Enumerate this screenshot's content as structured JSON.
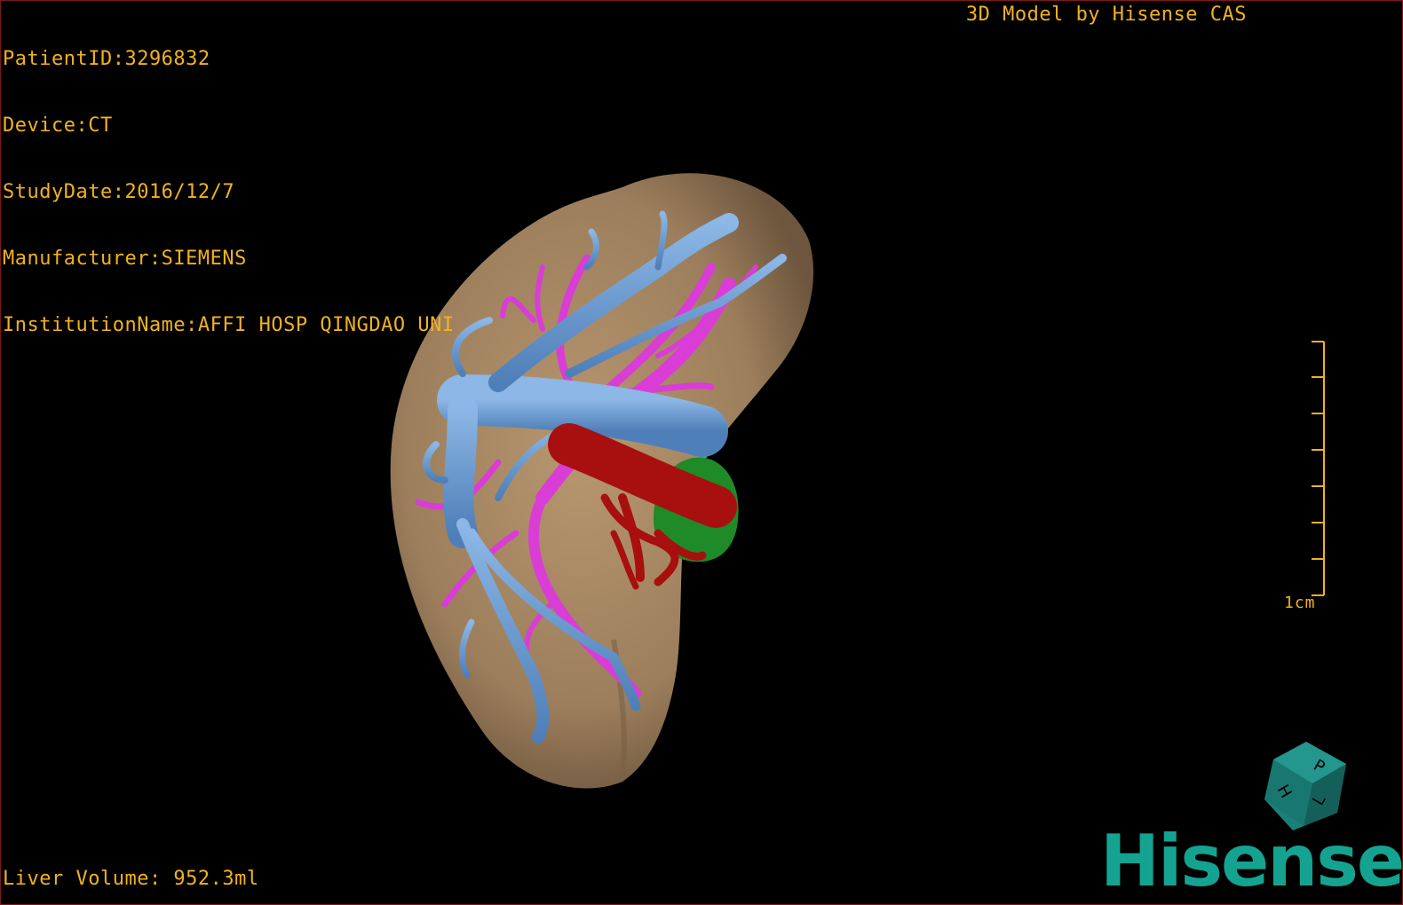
{
  "study_info": {
    "patient_id": "PatientID:3296832",
    "device": "Device:CT",
    "study_date": "StudyDate:2016/12/7",
    "manufacturer": "Manufacturer:SIEMENS",
    "institution": "InstitutionName:AFFI HOSP QINGDAO UNI"
  },
  "header": {
    "model_credit": "3D Model by Hisense CAS"
  },
  "footer": {
    "liver_volume": "Liver Volume: 952.3ml"
  },
  "scale": {
    "label": "1cm",
    "ticks": 8
  },
  "orientation_cube": {
    "faces": [
      "P",
      "L",
      "H"
    ],
    "icon": "orientation-cube-icon"
  },
  "brand": {
    "logo_text": "Hisense"
  },
  "colors": {
    "overlay_text": "#f2b21e",
    "liver": "#a98a66",
    "portal_vein": "#6e9fd6",
    "hepatic_vein": "#d93dd6",
    "artery": "#a80f0f",
    "tumor": "#1f8a28",
    "brand": "#15a391",
    "cube": "#17706a"
  }
}
